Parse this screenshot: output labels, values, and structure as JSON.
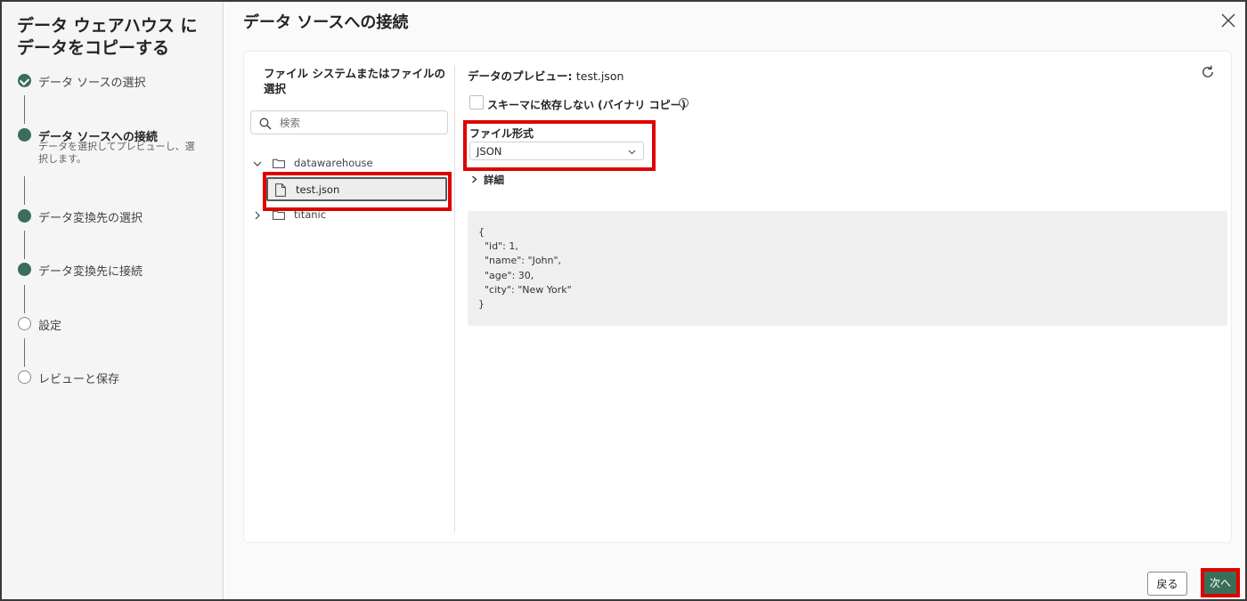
{
  "wizard": {
    "title": "データ ウェアハウス に データをコピーする",
    "steps": [
      {
        "label": "データ ソースの選択",
        "state": "done"
      },
      {
        "label": "データ ソースへの接続",
        "state": "active",
        "sub": "データを選択してプレビューし、選択します。"
      },
      {
        "label": "データ変換先の選択",
        "state": "filled"
      },
      {
        "label": "データ変換先に接続",
        "state": "filled"
      },
      {
        "label": "設定",
        "state": "empty"
      },
      {
        "label": "レビューと保存",
        "state": "empty"
      }
    ]
  },
  "main": {
    "title": "データ ソースへの接続",
    "close_icon": "close-icon"
  },
  "file_panel": {
    "heading": "ファイル システムまたはファイルの選択",
    "search_placeholder": "検索",
    "tree": [
      {
        "name": "datawarehouse",
        "expanded": true,
        "children": [
          {
            "name": "test.json",
            "selected": true
          }
        ]
      },
      {
        "name": "titanic",
        "expanded": false
      }
    ]
  },
  "preview": {
    "title_prefix": "データのプレビュー: ",
    "file_name": "test.json",
    "binary_copy_label": "スキーマに依存しない (バイナリ コピー)",
    "format_label": "ファイル形式",
    "format_value": "JSON",
    "details_label": "詳細",
    "json_lines": [
      "{",
      "  \"id\": 1,",
      "  \"name\": \"John\",",
      "  \"age\": 30,",
      "  \"city\": \"New York\"",
      "}"
    ]
  },
  "footer": {
    "back_label": "戻る",
    "next_label": "次へ"
  },
  "colors": {
    "accent": "#3a6e5a",
    "highlight": "#e00000"
  }
}
